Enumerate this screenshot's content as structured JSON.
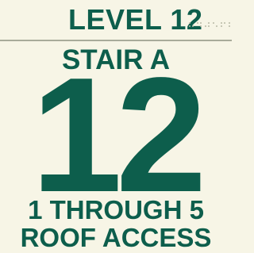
{
  "sign": {
    "level_label": "LEVEL 12",
    "stair_label": "STAIR A",
    "floor_number": "12",
    "floor_range": "1 THROUGH 5",
    "roof_access": "ROOF ACCESS"
  },
  "colors": {
    "text": "#0d5e4c",
    "background": "#f7f5e6",
    "divider": "#a9ab9a",
    "braille": "#b7b9a6"
  }
}
